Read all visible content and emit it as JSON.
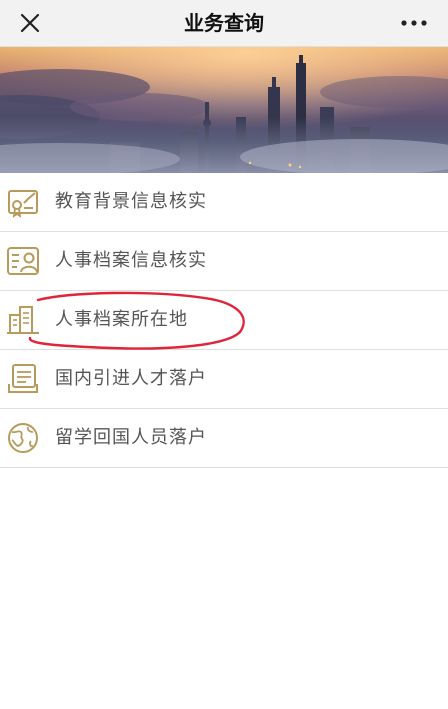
{
  "header": {
    "title": "业务查询",
    "close_icon": "close-icon",
    "more_icon": "more-dots-icon"
  },
  "banner": {
    "description_icon": "city-skyline-banner"
  },
  "menu": {
    "items": [
      {
        "label": "教育背景信息核实",
        "icon": "certificate-check-icon"
      },
      {
        "label": "人事档案信息核实",
        "icon": "id-card-person-icon"
      },
      {
        "label": "人事档案所在地",
        "icon": "buildings-icon"
      },
      {
        "label": "国内引进人才落户",
        "icon": "document-stack-icon"
      },
      {
        "label": "留学回国人员落户",
        "icon": "globe-icon"
      }
    ]
  },
  "colors": {
    "icon_gold": "#b89a5a",
    "annotation_red": "#e0243a",
    "label_gray": "#555555"
  }
}
